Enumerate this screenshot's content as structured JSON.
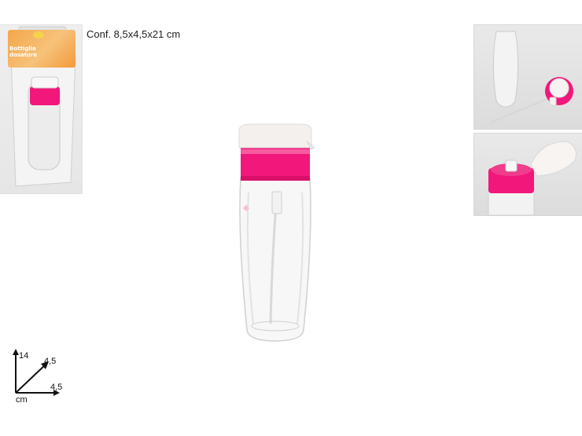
{
  "package": {
    "label_line1": "Bottiglia",
    "label_line2": "dosatore"
  },
  "dimensions": {
    "conf_text": "Conf. 8,5x4,5x21 cm",
    "height_label": "14",
    "depth_label": "4,5",
    "width_label": "4,5",
    "unit_label": "cm"
  },
  "colors": {
    "pump_cap": "#f2177a",
    "lid_clear": "#f4f0ee",
    "bottle_body": "#f7f7f7",
    "label_orange": "#f3a64a"
  },
  "icons": {
    "main_product": "dispenser-bottle-icon",
    "dimension_axes": "axes-icon"
  }
}
